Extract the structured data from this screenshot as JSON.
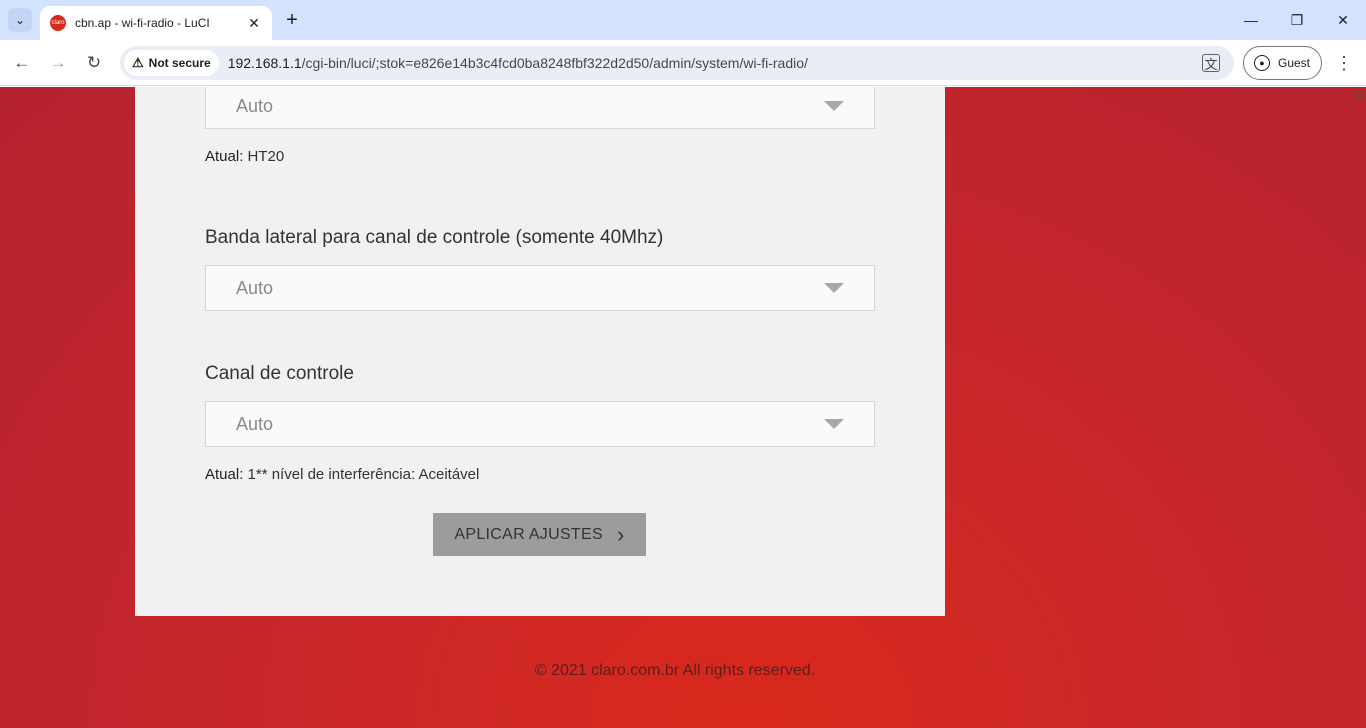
{
  "browser": {
    "tab_title": "cbn.ap - wi-fi-radio - LuCI",
    "favicon_text": "claro",
    "security_label": "Not secure",
    "url_host": "192.168.1.1",
    "url_path": "/cgi-bin/luci/;stok=e826e14b3c4fcd0ba8248fbf322d2d50/admin/system/wi-fi-radio/",
    "profile_label": "Guest"
  },
  "form": {
    "select_top": {
      "value": "Auto"
    },
    "current_top": {
      "label": "Atual:",
      "value": "HT20"
    },
    "sideband": {
      "label": "Banda lateral para canal de controle (somente 40Mhz)",
      "value": "Auto"
    },
    "control_channel": {
      "label": "Canal de controle",
      "value": "Auto"
    },
    "current_channel": {
      "label": "Atual:",
      "value": "1** nível de interferência: Aceitável"
    },
    "apply_label": "APLICAR AJUSTES"
  },
  "footer": {
    "text": "© 2021 claro.com.br All rights reserved."
  },
  "colors": {
    "brand_red": "#da291c",
    "card_bg": "#f1f1f1",
    "button_bg": "#9c9c9c"
  }
}
